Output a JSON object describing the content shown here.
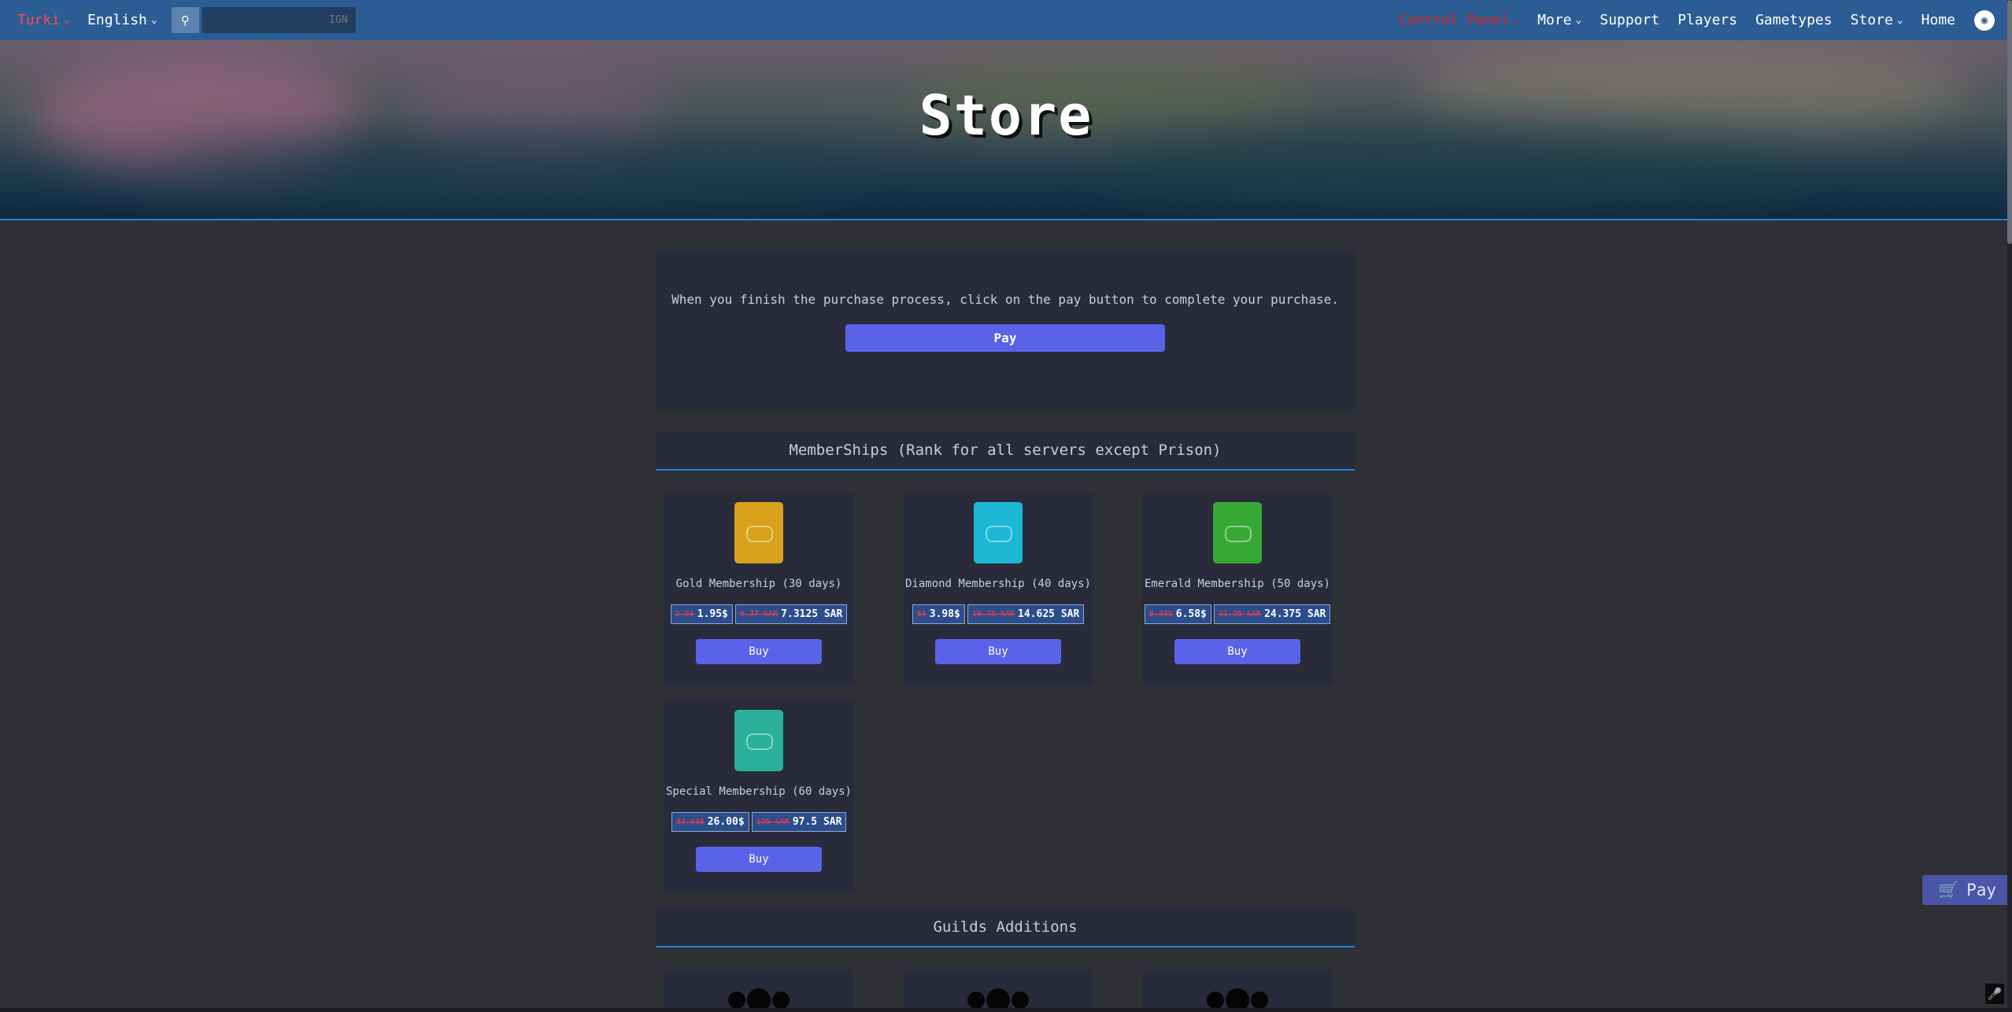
{
  "nav": {
    "left": [
      {
        "label": "Turki",
        "color": "red",
        "dropdown": true
      },
      {
        "label": "English",
        "dropdown": true
      }
    ],
    "search_placeholder": "IGN",
    "right": [
      {
        "label": "Control Panel",
        "color": "red",
        "dropdown": true
      },
      {
        "label": "More",
        "dropdown": true
      },
      {
        "label": "Support",
        "dropdown": false
      },
      {
        "label": "Players",
        "dropdown": false
      },
      {
        "label": "Gametypes",
        "dropdown": false
      },
      {
        "label": "Store",
        "dropdown": true
      },
      {
        "label": "Home",
        "dropdown": false
      }
    ]
  },
  "hero": {
    "title": "Store"
  },
  "pay_panel": {
    "message": "When you finish the purchase process, click on the pay button to complete your purchase.",
    "button": "Pay"
  },
  "memberships": {
    "heading": "MemberShips (Rank for all servers except Prison)",
    "items": [
      {
        "name": "Gold Membership (30 days)",
        "usd_old": "2.5$",
        "usd": "1.95$",
        "sar_old": "9.37 SAR",
        "sar": "7.3125 SAR",
        "buy": "Buy",
        "color": "#d9a21c"
      },
      {
        "name": "Diamond Membership (40 days)",
        "usd_old": "5$",
        "usd": "3.98$",
        "sar_old": "18.75 SAR",
        "sar": "14.625 SAR",
        "buy": "Buy",
        "color": "#1cb8d4"
      },
      {
        "name": "Emerald Membership (50 days)",
        "usd_old": "8.33$",
        "usd": "6.58$",
        "sar_old": "31.25 SAR",
        "sar": "24.375 SAR",
        "buy": "Buy",
        "color": "#38a834"
      },
      {
        "name": "Special Membership (60 days)",
        "usd_old": "33.33$",
        "usd": "26.00$",
        "sar_old": "125 SAR",
        "sar": "97.5 SAR",
        "buy": "Buy",
        "color": "#2ab09a"
      }
    ]
  },
  "guilds": {
    "heading": "Guilds Additions"
  },
  "float_pay": "Pay",
  "icons": {
    "search": "search-icon",
    "discord": "discord-icon",
    "cart": "cart-icon",
    "mic": "microphone-icon"
  }
}
